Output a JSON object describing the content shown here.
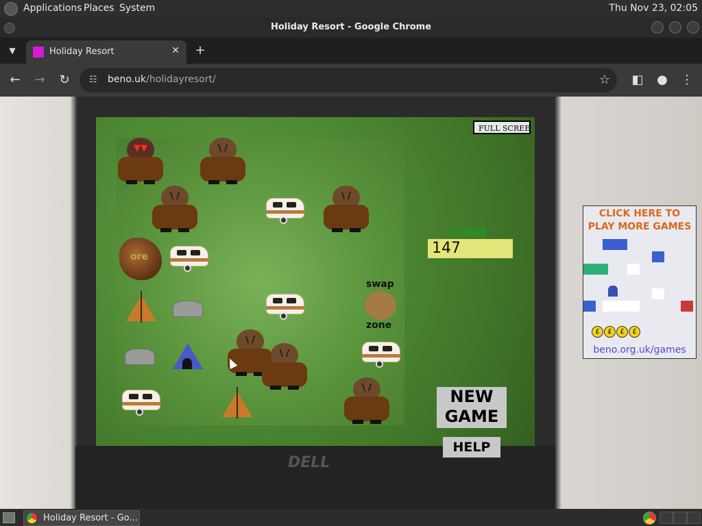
{
  "top_panel": {
    "menus": [
      "Applications",
      "Places",
      "System"
    ],
    "clock": "Thu Nov 23, 02:05"
  },
  "window": {
    "title": "Holiday Resort - Google Chrome"
  },
  "tabs": [
    {
      "title": "Holiday Resort",
      "close": "✕"
    }
  ],
  "toolbar": {
    "url_host": "beno.uk",
    "url_path": "/holidayresort/"
  },
  "icons": {
    "back": "back-icon",
    "forward": "forward-icon",
    "reload": "reload-icon",
    "bookmark": "star-icon",
    "side_panel": "side-panel-icon",
    "profile": "profile-icon",
    "menu": "kebab-menu-icon"
  },
  "game": {
    "fullscreen_label": "FULL SCREEN",
    "score_label": "SCORE",
    "score": "147",
    "swap_label": "swap",
    "zone_label": "zone",
    "new_game_label": "NEW\nGAME",
    "help_label": "HELP",
    "ore_label": "ore",
    "colors": {
      "grass": "#5b953d",
      "score_box": "#e4e57a",
      "score_text": "#1f9a1f"
    }
  },
  "ad": {
    "title": "CLICK HERE TO\nPLAY MORE GAMES",
    "url": "beno.org.uk/games",
    "coin": "£"
  },
  "taskbar": {
    "window_label": "Holiday Resort - Go..."
  }
}
